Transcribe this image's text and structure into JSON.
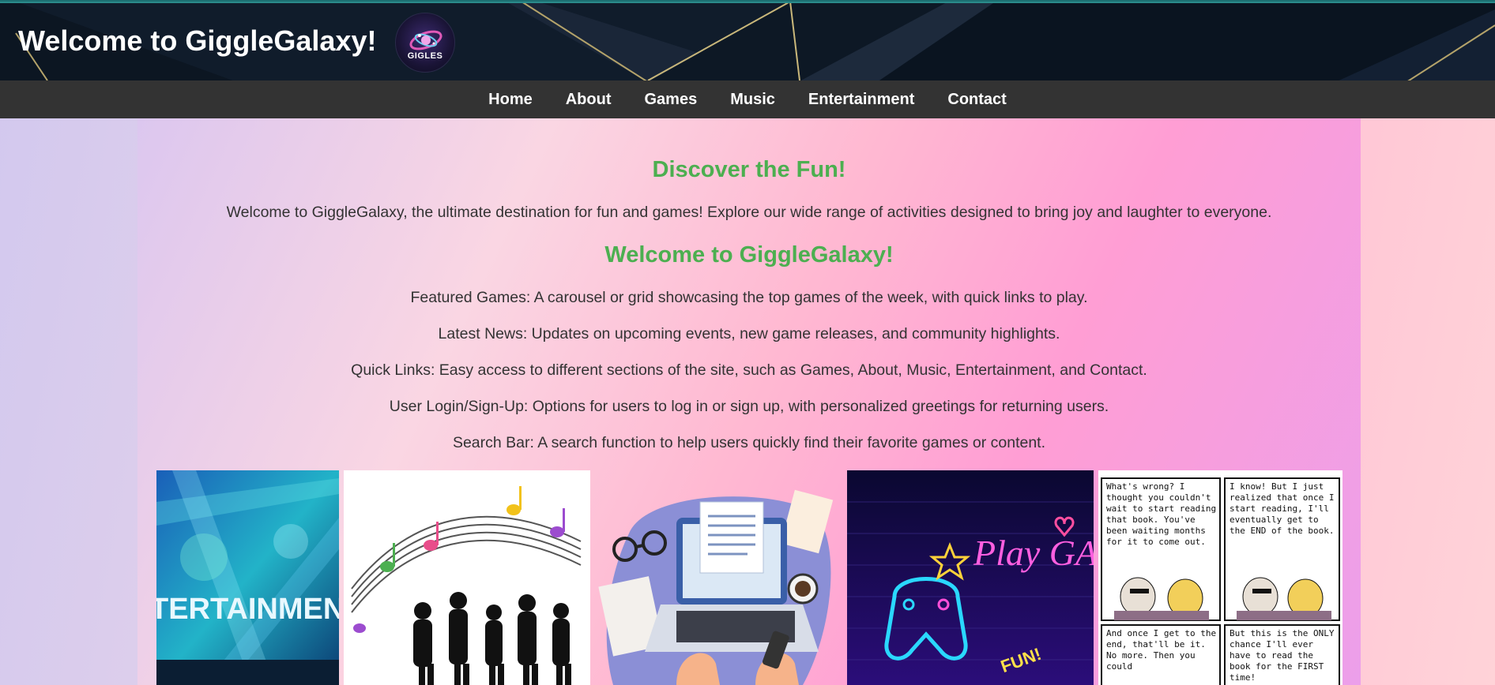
{
  "header": {
    "title": "Welcome to GiggleGalaxy!",
    "logo_text": "GIGLES"
  },
  "nav": {
    "items": [
      {
        "label": "Home"
      },
      {
        "label": "About"
      },
      {
        "label": "Games"
      },
      {
        "label": "Music"
      },
      {
        "label": "Entertainment"
      },
      {
        "label": "Contact"
      }
    ]
  },
  "main": {
    "heading1": "Discover the Fun!",
    "intro": "Welcome to GiggleGalaxy, the ultimate destination for fun and games! Explore our wide range of activities designed to bring joy and laughter to everyone.",
    "heading2": "Welcome to GiggleGalaxy!",
    "features": [
      "Featured Games: A carousel or grid showcasing the top games of the week, with quick links to play.",
      "Latest News: Updates on upcoming events, new game releases, and community highlights.",
      "Quick Links: Easy access to different sections of the site, such as Games, About, Music, Entertainment, and Contact.",
      "User Login/Sign-Up: Options for users to log in or sign up, with personalized greetings for returning users.",
      "Search Bar: A search function to help users quickly find their favorite games or content."
    ]
  },
  "gallery": {
    "entertainment_text": "TERTAINMENT",
    "games_text": "Play GAMES",
    "games_sub": "FUN!",
    "comic": [
      "What's wrong? I thought you couldn't wait to start reading that book. You've been waiting months for it to come out.",
      "I know! But I just realized that once I start reading, I'll eventually get to the END of the book.",
      "And once I get to the end, that'll be it. No more. Then you could",
      "But this is the ONLY chance I'll ever have to read the book for the FIRST time!"
    ]
  },
  "colors": {
    "heading": "#4caf50",
    "nav_bg": "#333333",
    "header_bg": "#0e1a29",
    "text": "#333333"
  }
}
